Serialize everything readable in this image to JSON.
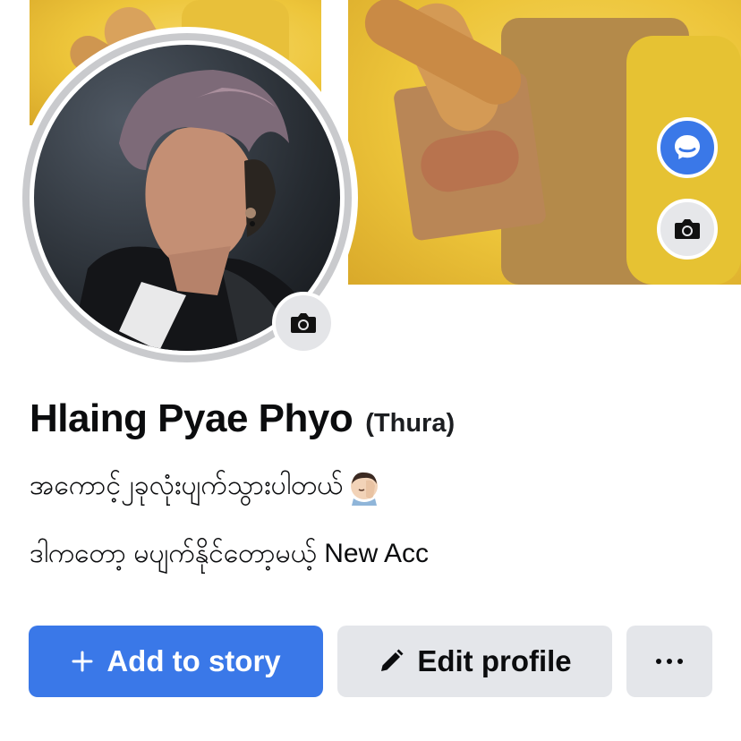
{
  "profile": {
    "name": "Hlaing Pyae Phyo",
    "alternate_name": "(Thura)",
    "bio_line_1": "အကောင့်၂ခုလုံးပျက်သွားပါတယ်",
    "bio_line_2": "ဒါကတော့ မပျက်နိုင်တော့မယ့် New Acc"
  },
  "actions": {
    "add_story_label": "Add to story",
    "edit_profile_label": "Edit profile"
  },
  "icons": {
    "cover_top_button": "messenger-icon",
    "cover_camera": "camera-icon",
    "avatar_camera": "camera-icon",
    "add": "plus-icon",
    "edit": "pencil-icon",
    "more": "more-horizontal-icon",
    "bio_emoji": "face-palm-emoji"
  },
  "colors": {
    "accent_blue": "#3a78e8",
    "button_grey": "#e4e6ea",
    "cover_yellow": "#edc53a"
  }
}
